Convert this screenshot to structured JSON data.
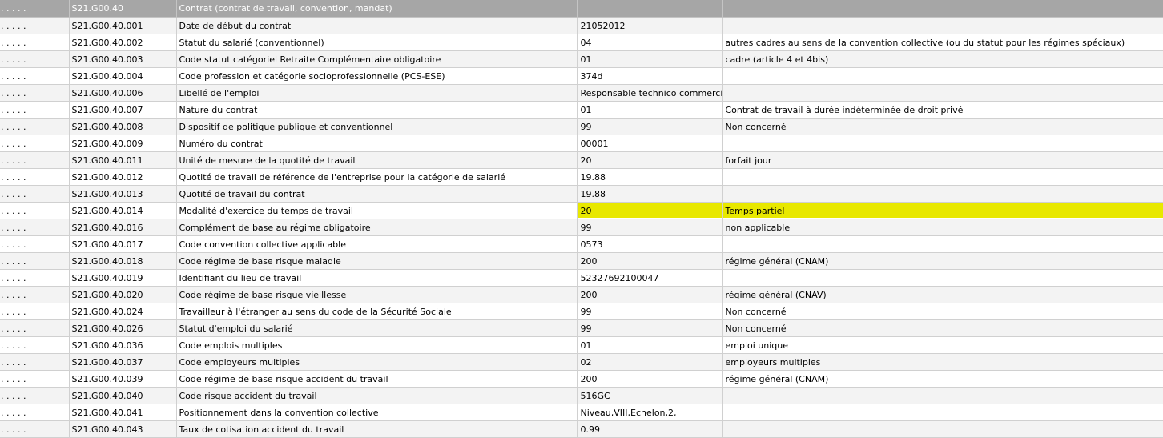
{
  "header": {
    "dots": ". . . . .",
    "code": "S21.G00.40",
    "label": "Contrat (contrat de travail, convention, mandat)",
    "value": "",
    "desc": ""
  },
  "rows": [
    {
      "dots": ". . . . .",
      "code": "S21.G00.40.001",
      "label": "Date de début du contrat",
      "value": "21052012",
      "desc": ""
    },
    {
      "dots": ". . . . .",
      "code": "S21.G00.40.002",
      "label": "Statut du salarié (conventionnel)",
      "value": "04",
      "desc": "autres cadres au sens de la convention collective (ou du statut pour les régimes spéciaux)"
    },
    {
      "dots": ". . . . .",
      "code": "S21.G00.40.003",
      "label": "Code statut catégoriel Retraite Complémentaire obligatoire",
      "value": "01",
      "desc": "cadre (article 4 et 4bis)"
    },
    {
      "dots": ". . . . .",
      "code": "S21.G00.40.004",
      "label": "Code profession et catégorie socioprofessionnelle (PCS-ESE)",
      "value": "374d",
      "desc": ""
    },
    {
      "dots": ". . . . .",
      "code": "S21.G00.40.006",
      "label": "Libellé de l'emploi",
      "value": "Responsable technico commercial",
      "desc": ""
    },
    {
      "dots": ". . . . .",
      "code": "S21.G00.40.007",
      "label": "Nature du contrat",
      "value": "01",
      "desc": "Contrat de travail à durée indéterminée de droit privé"
    },
    {
      "dots": ". . . . .",
      "code": "S21.G00.40.008",
      "label": "Dispositif de politique publique et conventionnel",
      "value": "99",
      "desc": "Non concerné"
    },
    {
      "dots": ". . . . .",
      "code": "S21.G00.40.009",
      "label": "Numéro du contrat",
      "value": "00001",
      "desc": ""
    },
    {
      "dots": ". . . . .",
      "code": "S21.G00.40.011",
      "label": "Unité de mesure de la quotité de travail",
      "value": "20",
      "desc": "forfait jour"
    },
    {
      "dots": ". . . . .",
      "code": "S21.G00.40.012",
      "label": "Quotité de travail de référence de l'entreprise pour la catégorie de salarié",
      "value": "19.88",
      "desc": ""
    },
    {
      "dots": ". . . . .",
      "code": "S21.G00.40.013",
      "label": "Quotité de travail du contrat",
      "value": "19.88",
      "desc": ""
    },
    {
      "dots": ". . . . .",
      "code": "S21.G00.40.014",
      "label": "Modalité d'exercice du temps de travail",
      "value": "20",
      "desc": "Temps partiel",
      "highlight": true
    },
    {
      "dots": ". . . . .",
      "code": "S21.G00.40.016",
      "label": "Complément de base au régime obligatoire",
      "value": "99",
      "desc": "non applicable"
    },
    {
      "dots": ". . . . .",
      "code": "S21.G00.40.017",
      "label": "Code convention collective applicable",
      "value": "0573",
      "desc": ""
    },
    {
      "dots": ". . . . .",
      "code": "S21.G00.40.018",
      "label": "Code régime de base risque maladie",
      "value": "200",
      "desc": "régime général (CNAM)"
    },
    {
      "dots": ". . . . .",
      "code": "S21.G00.40.019",
      "label": "Identifiant du lieu de travail",
      "value": "52327692100047",
      "desc": ""
    },
    {
      "dots": ". . . . .",
      "code": "S21.G00.40.020",
      "label": "Code régime de base risque vieillesse",
      "value": "200",
      "desc": "régime général (CNAV)"
    },
    {
      "dots": ". . . . .",
      "code": "S21.G00.40.024",
      "label": "Travailleur à l'étranger au sens du code de la Sécurité Sociale",
      "value": "99",
      "desc": "Non concerné"
    },
    {
      "dots": ". . . . .",
      "code": "S21.G00.40.026",
      "label": "Statut d'emploi du salarié",
      "value": "99",
      "desc": "Non concerné"
    },
    {
      "dots": ". . . . .",
      "code": "S21.G00.40.036",
      "label": "Code emplois multiples",
      "value": "01",
      "desc": "emploi unique"
    },
    {
      "dots": ". . . . .",
      "code": "S21.G00.40.037",
      "label": "Code employeurs multiples",
      "value": "02",
      "desc": "employeurs multiples"
    },
    {
      "dots": ". . . . .",
      "code": "S21.G00.40.039",
      "label": "Code régime de base risque accident du travail",
      "value": "200",
      "desc": "régime général (CNAM)"
    },
    {
      "dots": ". . . . .",
      "code": "S21.G00.40.040",
      "label": "Code risque accident du travail",
      "value": "516GC",
      "desc": ""
    },
    {
      "dots": ". . . . .",
      "code": "S21.G00.40.041",
      "label": "Positionnement dans la convention collective",
      "value": "Niveau,VIII,Echelon,2,",
      "desc": ""
    },
    {
      "dots": ". . . . .",
      "code": "S21.G00.40.043",
      "label": "Taux de cotisation accident du travail",
      "value": "0.99",
      "desc": ""
    }
  ],
  "colors": {
    "header_bg": "#a6a6a6",
    "highlight": "#e8e800"
  }
}
